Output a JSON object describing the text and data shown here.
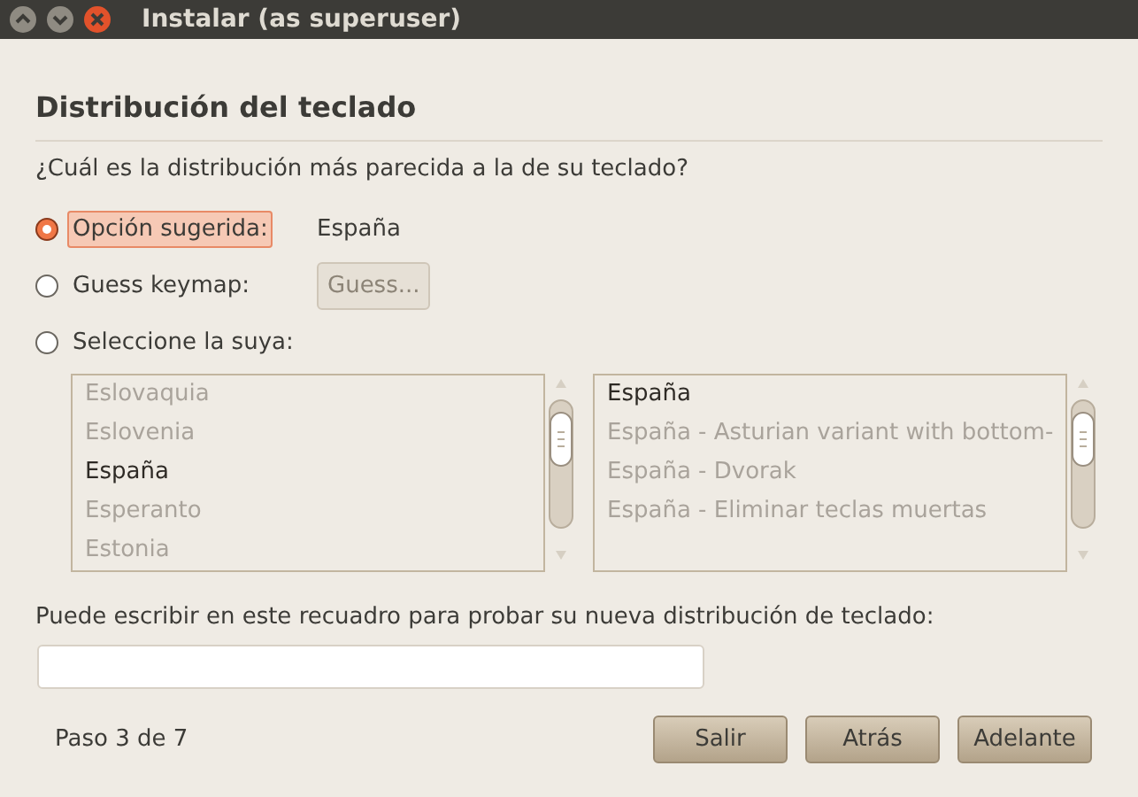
{
  "window": {
    "title": "Instalar (as superuser)"
  },
  "heading": "Distribución del teclado",
  "question": "¿Cuál es la distribución más parecida a la de su teclado?",
  "options": [
    {
      "kind": "value",
      "label": "Opción sugerida:",
      "selected": true,
      "value": "España"
    },
    {
      "kind": "button",
      "label": "Guess keymap:",
      "selected": false,
      "button": {
        "label": "Guess...",
        "disabled": true
      }
    },
    {
      "kind": "plain",
      "label": "Seleccione la suya:",
      "selected": false
    }
  ],
  "lists_disabled": true,
  "layouts": [
    {
      "label": "Eslovaquia",
      "selected": false
    },
    {
      "label": "Eslovenia",
      "selected": false
    },
    {
      "label": "España",
      "selected": true
    },
    {
      "label": "Esperanto",
      "selected": false
    },
    {
      "label": "Estonia",
      "selected": false
    }
  ],
  "variants": [
    {
      "label": "España",
      "selected": true
    },
    {
      "label": "España - Asturian variant with bottom-",
      "selected": false
    },
    {
      "label": "España - Dvorak",
      "selected": false
    },
    {
      "label": "España - Eliminar teclas muertas",
      "selected": false
    }
  ],
  "test_label": "Puede escribir en este recuadro para probar su nueva distribución de teclado:",
  "step": "Paso 3 de 7",
  "buttons": [
    "Salir",
    "Atrás",
    "Adelante"
  ]
}
